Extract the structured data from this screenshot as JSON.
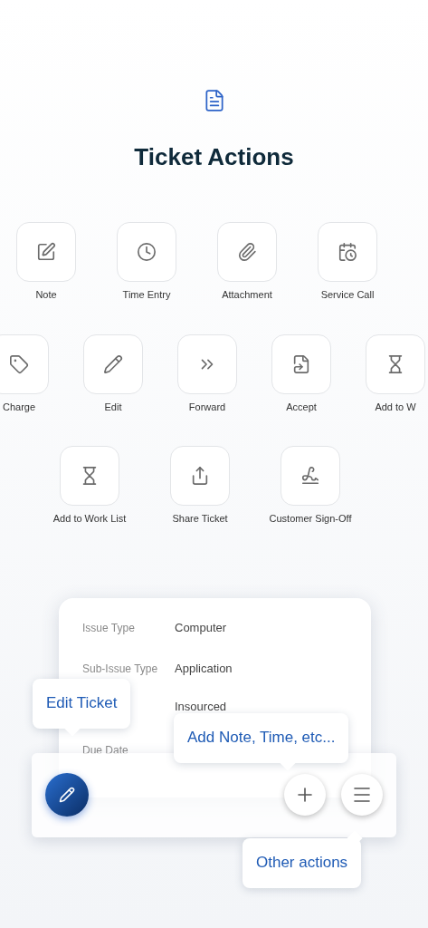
{
  "header": {
    "title": "Ticket Actions"
  },
  "action_rows": [
    [
      {
        "kind": "note",
        "label": "Note"
      },
      {
        "kind": "clock",
        "label": "Time Entry"
      },
      {
        "kind": "attachment",
        "label": "Attachment"
      },
      {
        "kind": "calendar",
        "label": "Service Call"
      }
    ],
    [
      {
        "kind": "tag",
        "label": "Charge"
      },
      {
        "kind": "pencil",
        "label": "Edit"
      },
      {
        "kind": "forward",
        "label": "Forward"
      },
      {
        "kind": "accept",
        "label": "Accept"
      },
      {
        "kind": "hourglass",
        "label": "Add to W"
      }
    ],
    [
      {
        "kind": "hourglass",
        "label": "Add to Work List"
      },
      {
        "kind": "share",
        "label": "Share Ticket"
      },
      {
        "kind": "signature",
        "label": "Customer Sign-Off"
      }
    ]
  ],
  "ticket_card": {
    "fields": [
      {
        "label": "Issue Type",
        "value": "Computer"
      },
      {
        "label": "Sub-Issue Type",
        "value": "Application"
      },
      {
        "value": "Insourced"
      },
      {
        "label": "Due Date"
      }
    ]
  },
  "tooltips": [
    {
      "kind": "edit",
      "text": "Edit Ticket"
    },
    {
      "kind": "add",
      "text": "Add Note, Time, etc..."
    },
    {
      "kind": "other",
      "text": "Other actions"
    }
  ]
}
